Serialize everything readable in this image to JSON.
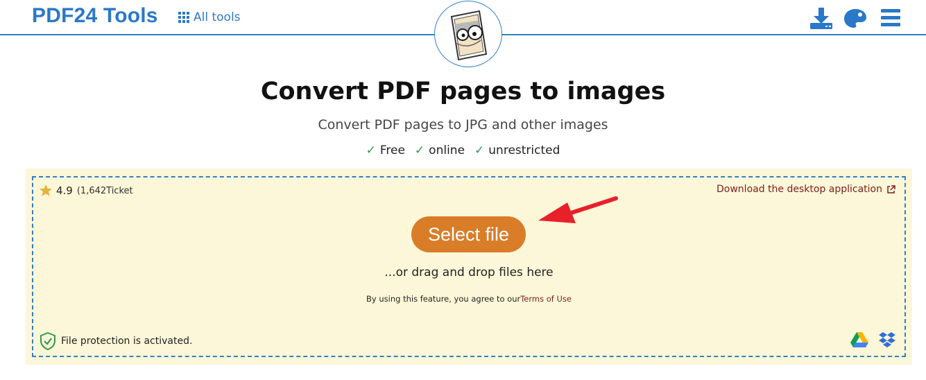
{
  "header": {
    "brand": "PDF24 Tools",
    "all_tools_label": "All tools",
    "icons": [
      "download-icon",
      "palette-icon",
      "hamburger-menu-icon"
    ]
  },
  "logo": {
    "icon": "pdf24-mascot-icon"
  },
  "main": {
    "title": "Convert PDF pages to images",
    "subtitle": "Convert PDF pages to JPG and other images",
    "features": [
      {
        "check": "✓",
        "label": "Free"
      },
      {
        "check": "✓",
        "label": "online"
      },
      {
        "check": "✓",
        "label": "unrestricted"
      }
    ]
  },
  "upload": {
    "rating_score": "4.9",
    "rating_count": "(1,642Ticket",
    "download_desktop_label": "Download the desktop application",
    "select_file_label": "Select file",
    "drag_drop_text": "...or drag and drop files here",
    "terms_prefix": "By using this feature, you agree to our",
    "terms_link": "Terms of Use",
    "protection_text": "File protection is activated.",
    "cloud_icons": [
      "google-drive-icon",
      "dropbox-icon"
    ]
  },
  "colors": {
    "brand_blue": "#2a78c8",
    "select_button": "#d97d28",
    "panel_bg": "#fdf7d9",
    "link_dark_red": "#7a1f1f",
    "check_green": "#2e9a4a",
    "annotation_arrow": "#e8202a"
  }
}
